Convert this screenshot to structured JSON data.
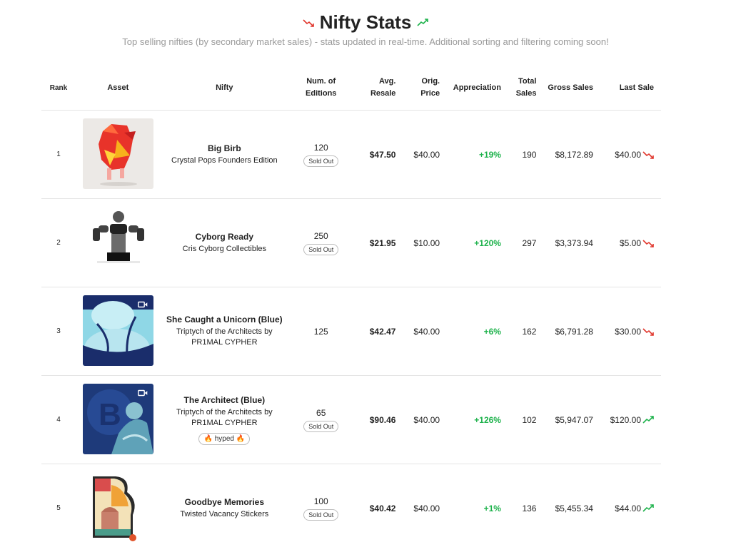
{
  "header": {
    "title": "Nifty Stats",
    "subtitle": "Top selling nifties (by secondary market sales) - stats updated in real-time. Additional sorting and filtering coming soon!"
  },
  "columns": {
    "rank": "Rank",
    "asset": "Asset",
    "nifty": "Nifty",
    "editions_1": "Num. of",
    "editions_2": "Editions",
    "avg_1": "Avg.",
    "avg_2": "Resale",
    "orig_1": "Orig.",
    "orig_2": "Price",
    "appreciation": "Appreciation",
    "total_1": "Total",
    "total_2": "Sales",
    "gross": "Gross Sales",
    "last": "Last Sale"
  },
  "colors": {
    "up": "#1db24b",
    "down": "#e0352b"
  },
  "rows": [
    {
      "rank": "1",
      "name": "Big Birb",
      "collection": "Crystal Pops Founders Edition",
      "collection_2": "",
      "editions": "120",
      "badge": "Sold Out",
      "hyped": "",
      "avg_resale": "$47.50",
      "orig_price": "$40.00",
      "appreciation": "+19%",
      "total_sales": "190",
      "gross_sales": "$8,172.89",
      "last_sale": "$40.00",
      "trend": "down",
      "thumb": "red-bird",
      "video": false
    },
    {
      "rank": "2",
      "name": "Cyborg Ready",
      "collection": "Cris Cyborg Collectibles",
      "collection_2": "",
      "editions": "250",
      "badge": "Sold Out",
      "hyped": "",
      "avg_resale": "$21.95",
      "orig_price": "$10.00",
      "appreciation": "+120%",
      "total_sales": "297",
      "gross_sales": "$3,373.94",
      "last_sale": "$5.00",
      "trend": "down",
      "thumb": "fighter",
      "video": false
    },
    {
      "rank": "3",
      "name": "She Caught a Unicorn (Blue)",
      "collection": "Triptych of the Architects by",
      "collection_2": "PR1MAL CYPHER",
      "editions": "125",
      "badge": "",
      "hyped": "",
      "avg_resale": "$42.47",
      "orig_price": "$40.00",
      "appreciation": "+6%",
      "total_sales": "162",
      "gross_sales": "$6,791.28",
      "last_sale": "$30.00",
      "trend": "down",
      "thumb": "blue-unicorn",
      "video": true
    },
    {
      "rank": "4",
      "name": "The Architect (Blue)",
      "collection": "Triptych of the Architects by",
      "collection_2": "PR1MAL CYPHER",
      "editions": "65",
      "badge": "Sold Out",
      "hyped": "🔥 hyped 🔥",
      "avg_resale": "$90.46",
      "orig_price": "$40.00",
      "appreciation": "+126%",
      "total_sales": "102",
      "gross_sales": "$5,947.07",
      "last_sale": "$120.00",
      "trend": "up",
      "thumb": "blue-architect",
      "video": true
    },
    {
      "rank": "5",
      "name": "Goodbye Memories",
      "collection": "Twisted Vacancy Stickers",
      "collection_2": "",
      "editions": "100",
      "badge": "Sold Out",
      "hyped": "",
      "avg_resale": "$40.42",
      "orig_price": "$40.00",
      "appreciation": "+1%",
      "total_sales": "136",
      "gross_sales": "$5,455.34",
      "last_sale": "$44.00",
      "trend": "up",
      "thumb": "sticker",
      "video": true
    }
  ]
}
